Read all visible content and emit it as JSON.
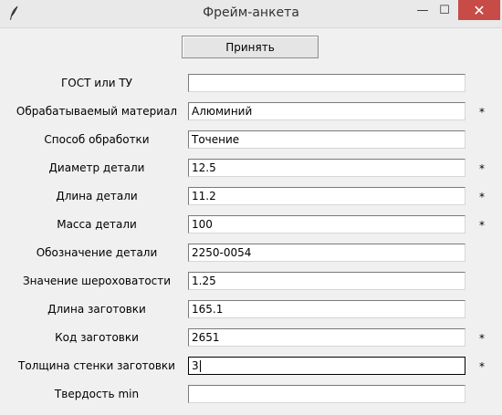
{
  "window": {
    "title": "Фрейм-анкета",
    "min_symbol": "—",
    "max_symbol": "☐",
    "close_symbol": "✕"
  },
  "accept_button": {
    "label": "Принять"
  },
  "required_marker": "*",
  "fields": [
    {
      "label": "ГОСТ или ТУ",
      "value": "",
      "required": false
    },
    {
      "label": "Обрабатываемый материал",
      "value": "Алюминий",
      "required": true
    },
    {
      "label": "Способ обработки",
      "value": "Точение",
      "required": false
    },
    {
      "label": "Диаметр детали",
      "value": "12.5",
      "required": true
    },
    {
      "label": "Длина детали",
      "value": "11.2",
      "required": true
    },
    {
      "label": "Масса детали",
      "value": "100",
      "required": true
    },
    {
      "label": "Обозначение детали",
      "value": "2250-0054",
      "required": false
    },
    {
      "label": "Значение шероховатости",
      "value": "1.25",
      "required": false
    },
    {
      "label": "Длина заготовки",
      "value": "165.1",
      "required": false
    },
    {
      "label": "Код заготовки",
      "value": "2651",
      "required": true
    },
    {
      "label": "Толщина стенки заготовки",
      "value": "3",
      "required": true,
      "focused": true
    },
    {
      "label": "Твердость min",
      "value": "",
      "required": false
    }
  ]
}
